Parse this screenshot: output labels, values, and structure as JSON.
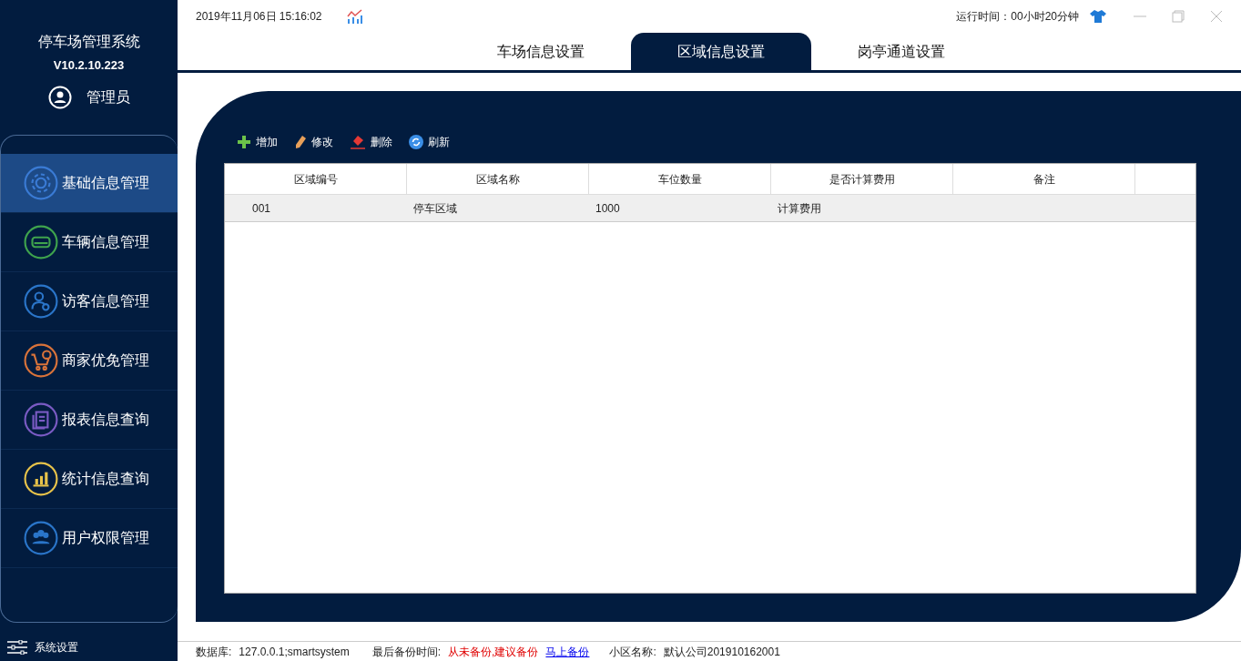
{
  "app": {
    "title": "停车场管理系统",
    "version": "V10.2.10.223",
    "user": "管理员"
  },
  "nav": [
    {
      "label": "基础信息管理",
      "kind": "gear",
      "color": "#3a7bd5",
      "selected": true
    },
    {
      "label": "车辆信息管理",
      "kind": "car",
      "color": "#3fa34d",
      "selected": false
    },
    {
      "label": "访客信息管理",
      "kind": "visitor",
      "color": "#2a75c9",
      "selected": false
    },
    {
      "label": "商家优免管理",
      "kind": "cart",
      "color": "#d9733a",
      "selected": false
    },
    {
      "label": "报表信息查询",
      "kind": "report",
      "color": "#7a5bc4",
      "selected": false
    },
    {
      "label": "统计信息查询",
      "kind": "chart",
      "color": "#e8c34a",
      "selected": false
    },
    {
      "label": "用户权限管理",
      "kind": "users",
      "color": "#2a75c9",
      "selected": false
    }
  ],
  "settings": "系统设置",
  "header": {
    "datetime": "2019年11月06日 15:16:02",
    "runtime": "运行时间：00小时20分钟"
  },
  "tabs": [
    {
      "label": "车场信息设置",
      "selected": false
    },
    {
      "label": "区域信息设置",
      "selected": true
    },
    {
      "label": "岗亭通道设置",
      "selected": false
    }
  ],
  "toolbar": [
    {
      "label": "增加",
      "kind": "add"
    },
    {
      "label": "修改",
      "kind": "edit"
    },
    {
      "label": "删除",
      "kind": "delete"
    },
    {
      "label": "刷新",
      "kind": "refresh"
    }
  ],
  "table": {
    "columns": [
      "区域编号",
      "区域名称",
      "车位数量",
      "是否计算费用",
      "备注"
    ],
    "rows": [
      {
        "cells": [
          "001",
          "停车区域",
          "1000",
          "计算费用",
          ""
        ],
        "selected": true
      }
    ]
  },
  "status_bar": {
    "db_label": "数据库:",
    "db": "127.0.0.1;smartsystem",
    "backup_label": "最后备份时间:",
    "backup": "从未备份,建议备份",
    "backup_link": "马上备份",
    "site_label": "小区名称:",
    "site": "默认公司201910162001"
  }
}
